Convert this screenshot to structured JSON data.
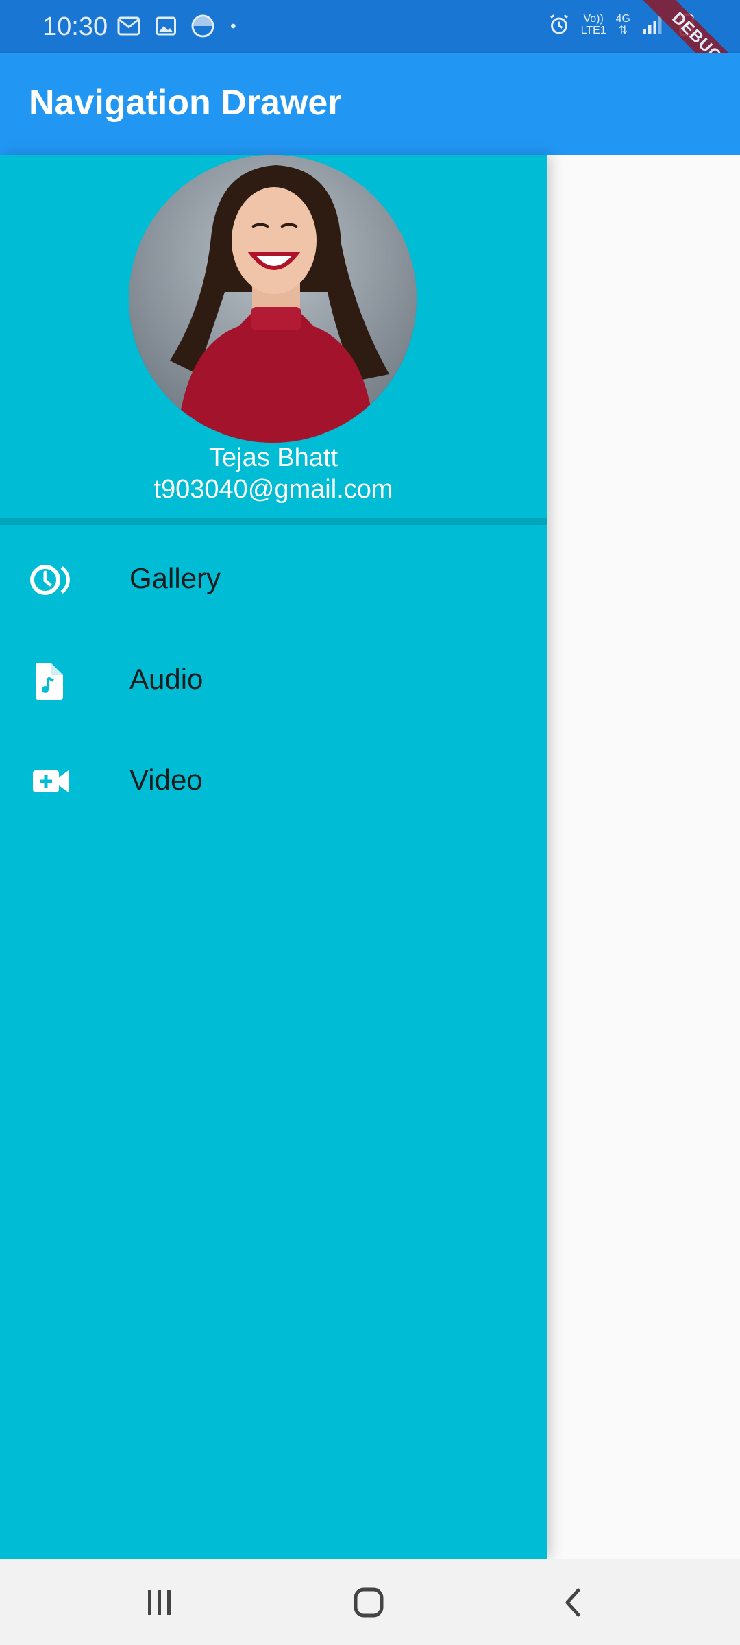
{
  "status_bar": {
    "time": "10:30",
    "left_icons": [
      "gmail-icon",
      "image-icon",
      "pinwheel-icon",
      "dot-icon"
    ],
    "network_top": "Vo))",
    "network_bottom": "LTE1",
    "network_gen": "4G"
  },
  "debug_banner": "DEBUG",
  "app_bar": {
    "title": "Navigation Drawer"
  },
  "drawer": {
    "header": {
      "name": "Tejas Bhatt",
      "email": "t903040@gmail.com"
    },
    "items": [
      {
        "label": "Gallery",
        "icon": "slow-motion-video-icon"
      },
      {
        "label": "Audio",
        "icon": "audio-file-icon"
      },
      {
        "label": "Video",
        "icon": "video-call-icon"
      }
    ]
  },
  "colors": {
    "status_bar": "#1976d2",
    "app_bar": "#2196f3",
    "drawer": "#00bcd4",
    "background": "#fafafa"
  }
}
